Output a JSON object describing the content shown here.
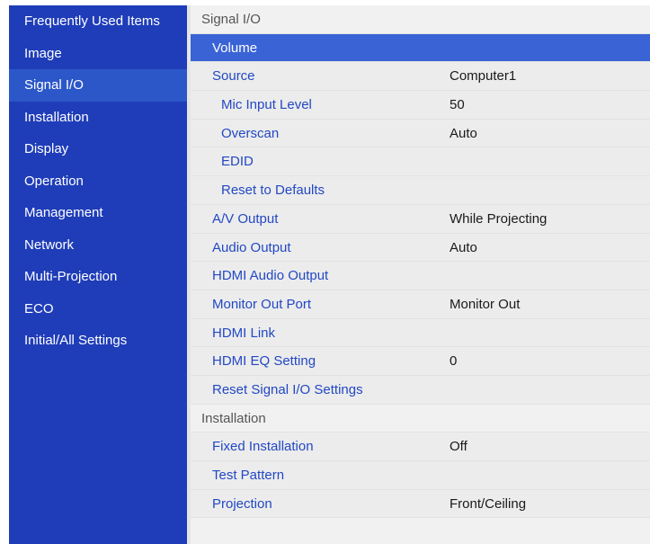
{
  "sidebar": {
    "items": [
      {
        "label": "Frequently Used Items"
      },
      {
        "label": "Image"
      },
      {
        "label": "Signal I/O"
      },
      {
        "label": "Installation"
      },
      {
        "label": "Display"
      },
      {
        "label": "Operation"
      },
      {
        "label": "Management"
      },
      {
        "label": "Network"
      },
      {
        "label": "Multi-Projection"
      },
      {
        "label": "ECO"
      },
      {
        "label": "Initial/All Settings"
      }
    ],
    "active_index": 2
  },
  "main": {
    "signal_header": "Signal I/O",
    "signal_rows": [
      {
        "label": "Volume",
        "value": ""
      },
      {
        "label": "Source",
        "value": "Computer1"
      },
      {
        "label": "Mic Input Level",
        "value": "50"
      },
      {
        "label": "Overscan",
        "value": "Auto"
      },
      {
        "label": "EDID",
        "value": ""
      },
      {
        "label": "Reset to Defaults",
        "value": ""
      },
      {
        "label": "A/V Output",
        "value": "While Projecting"
      },
      {
        "label": "Audio Output",
        "value": "Auto"
      },
      {
        "label": "HDMI Audio Output",
        "value": ""
      },
      {
        "label": "Monitor Out Port",
        "value": "Monitor Out"
      },
      {
        "label": "HDMI Link",
        "value": ""
      },
      {
        "label": "HDMI EQ Setting",
        "value": "0"
      },
      {
        "label": "Reset Signal I/O Settings",
        "value": ""
      }
    ],
    "installation_header": "Installation",
    "installation_rows": [
      {
        "label": "Fixed Installation",
        "value": "Off"
      },
      {
        "label": "Test Pattern",
        "value": ""
      },
      {
        "label": "Projection",
        "value": "Front/Ceiling"
      }
    ]
  },
  "colors": {
    "sidebar_bg": "#1f3db8",
    "sidebar_active": "#2c57c9",
    "selected_row": "#3a63d6",
    "item_text": "#2248c4"
  }
}
